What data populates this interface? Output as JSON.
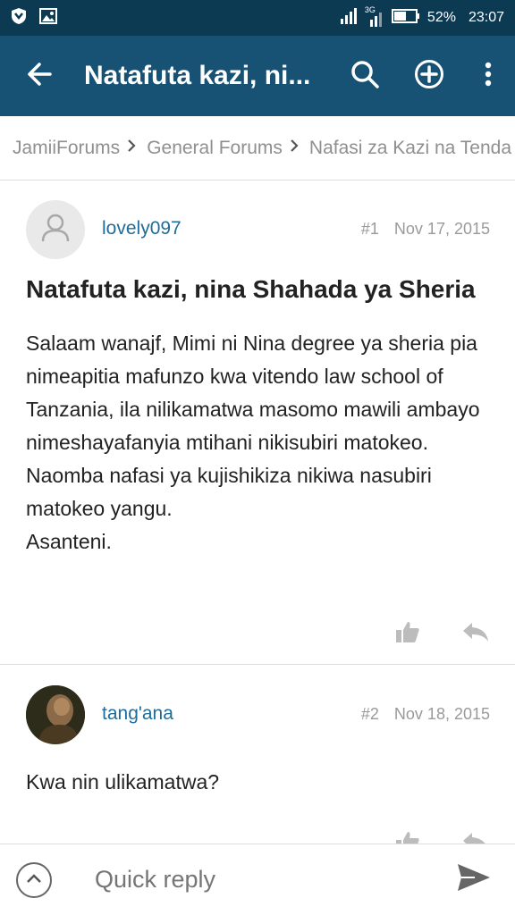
{
  "status_bar": {
    "network_label": "3G",
    "battery": "52%",
    "time": "23:07"
  },
  "app_bar": {
    "title": "Natafuta kazi, ni..."
  },
  "breadcrumb": {
    "items": [
      "JamiiForums",
      "General Forums",
      "Nafasi za Kazi na Tenda"
    ]
  },
  "posts": [
    {
      "username": "lovely097",
      "number": "#1",
      "date": "Nov 17, 2015",
      "title": "Natafuta kazi, nina Shahada ya Sheria",
      "body_lines": [
        "Salaam wanajf, Mimi ni Nina degree ya sheria pia nimeapitia mafunzo kwa vitendo law school of Tanzania, ila nilikamatwa masomo mawili ambayo nimeshayafanyia mtihani nikisubiri matokeo.",
        "Naomba nafasi ya kujishikiza nikiwa nasubiri matokeo yangu.",
        "Asanteni."
      ]
    },
    {
      "username": "tang'ana",
      "number": "#2",
      "date": "Nov 18, 2015",
      "body_lines": [
        "Kwa nin ulikamatwa?"
      ]
    }
  ],
  "quick_reply": {
    "placeholder": "Quick reply"
  }
}
